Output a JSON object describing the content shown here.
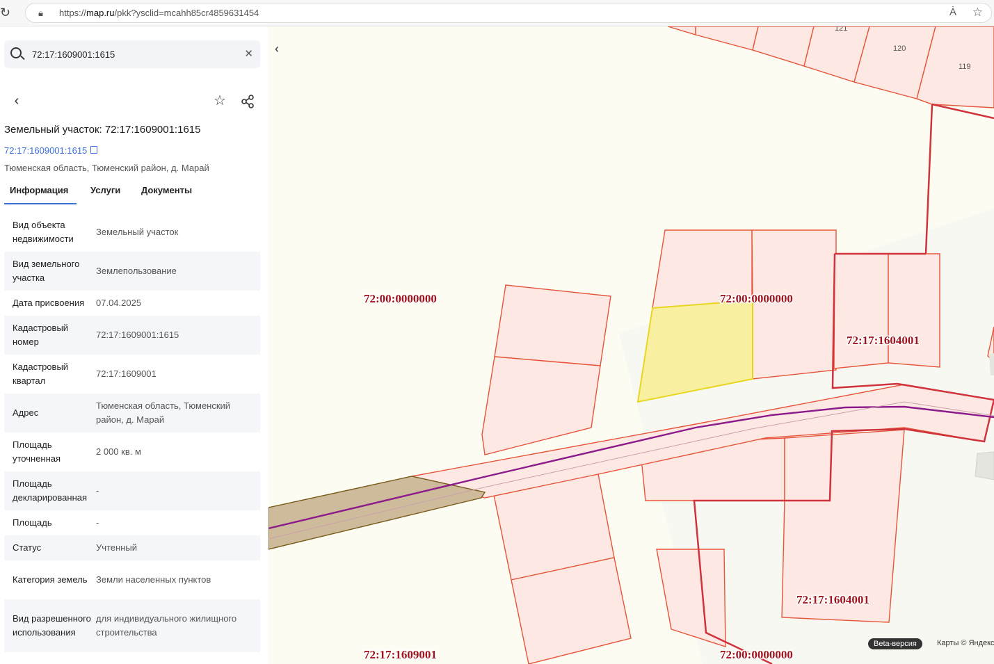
{
  "browser": {
    "url_prefix": "https://",
    "url_host": "map.ru",
    "url_path": "/pkk?ysclid=mcahh85cr4859631454"
  },
  "search": {
    "value": "72:17:1609001:1615"
  },
  "card": {
    "title": "Земельный участок: 72:17:1609001:1615",
    "cad_link": "72:17:1609001:1615",
    "address": "Тюменская область, Тюменский район, д. Марай"
  },
  "tabs": [
    {
      "label": "Информация"
    },
    {
      "label": "Услуги"
    },
    {
      "label": "Документы"
    }
  ],
  "info": [
    {
      "key": "Вид объекта недвижимости",
      "value": "Земельный участок"
    },
    {
      "key": "Вид земельного участка",
      "value": "Землепользование"
    },
    {
      "key": "Дата присвоения",
      "value": "07.04.2025"
    },
    {
      "key": "Кадастровый номер",
      "value": "72:17:1609001:1615"
    },
    {
      "key": "Кадастровый квартал",
      "value": "72:17:1609001"
    },
    {
      "key": "Адрес",
      "value": "Тюменская область, Тюменский район, д. Марай"
    },
    {
      "key": "Площадь уточненная",
      "value": "2 000 кв. м"
    },
    {
      "key": "Площадь декларированная",
      "value": "-"
    },
    {
      "key": "Площадь",
      "value": "-"
    },
    {
      "key": "Статус",
      "value": "Учтенный"
    },
    {
      "key": "Категория земель",
      "value": "Земли населенных пунктов"
    },
    {
      "key": "Вид разрешенного использования",
      "value": "для индивидуального жилищного строительства"
    }
  ],
  "map": {
    "labels": {
      "q1": "72:00:0000000",
      "q2": "72:00:0000000",
      "q3": "72:17:1604001",
      "q4": "72:17:1604001",
      "q5": "72:17:1609001",
      "q6": "72:00:0000000",
      "p121": "121",
      "p120": "120",
      "p119": "119"
    },
    "badge": "Beta-версия",
    "attribution": "Карты © Яндекс",
    "colors": {
      "parcel_fill": "#fde8e3",
      "parcel_stroke": "#e6553a",
      "selected_fill": "#f8f0a0",
      "selected_stroke": "#e8d620",
      "quarter_stroke": "#d0333b",
      "road": "#8b1a8b",
      "label": "#a0141e",
      "brown_fill": "#cdbb9b"
    }
  }
}
